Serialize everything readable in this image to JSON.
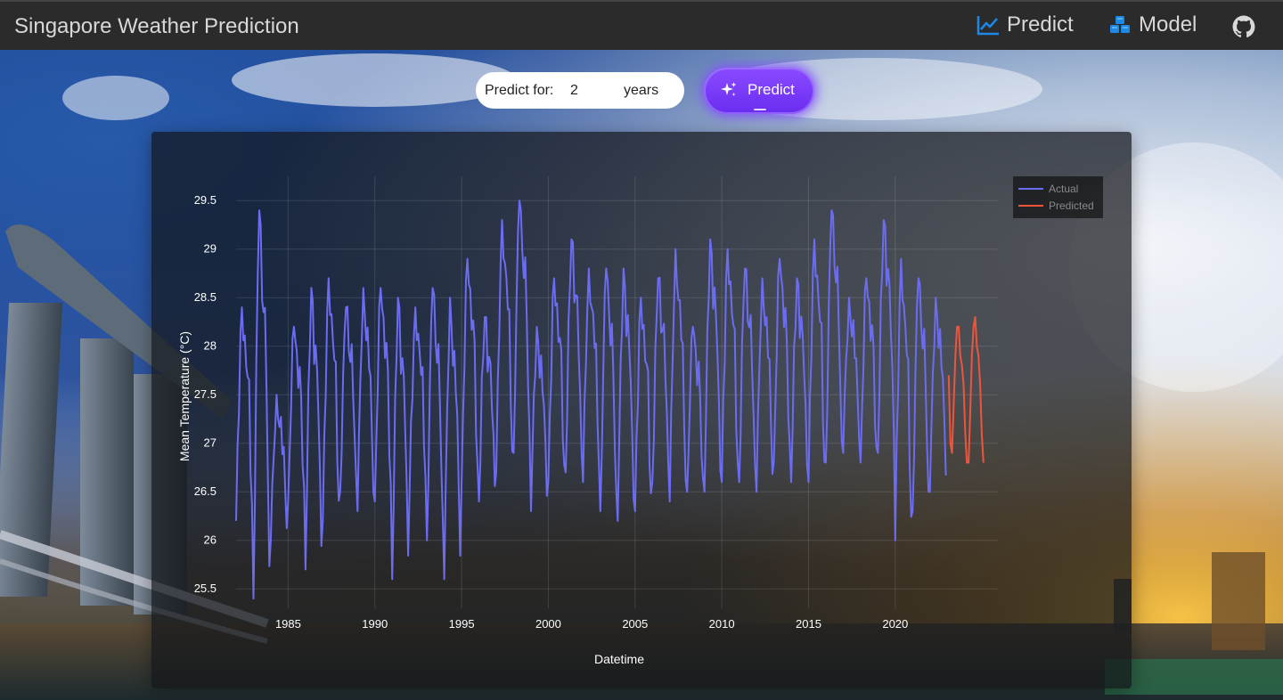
{
  "navbar": {
    "title": "Singapore Weather Prediction",
    "items": [
      {
        "label": "Predict",
        "icon": "line-chart-icon"
      },
      {
        "label": "Model",
        "icon": "cubes-icon"
      },
      {
        "label": "",
        "icon": "github-icon"
      }
    ]
  },
  "controls": {
    "predict_for_label": "Predict for:",
    "years_value": "2",
    "years_unit": "years",
    "predict_button_label": "Predict",
    "predict_button_icon": "sparkles-icon"
  },
  "colors": {
    "actual": "#6b6cf2",
    "predicted": "#ef553b",
    "nav_accent": "#1e88e5",
    "button": "#7a3cff"
  },
  "chart_data": {
    "type": "line",
    "xlabel": "Datetime",
    "ylabel": "Mean Temperature (°C)",
    "x_ticks": [
      1985,
      1990,
      1995,
      2000,
      2005,
      2010,
      2015,
      2020
    ],
    "y_ticks": [
      25.5,
      26,
      26.5,
      27,
      27.5,
      28,
      28.5,
      29,
      29.5
    ],
    "xlim": [
      "1982-01",
      "2025-12"
    ],
    "ylim": [
      25.3,
      29.75
    ],
    "grid": true,
    "legend_position": "top-right",
    "seasonal_pattern": [
      26.2,
      26.9,
      27.6,
      28.2,
      28.6,
      28.4,
      28.1,
      28.0,
      27.9,
      27.6,
      26.9,
      26.4
    ],
    "series": [
      {
        "name": "Actual",
        "start": "1982-01",
        "end": "2023-02",
        "annual_peaks": [
          28.4,
          29.4,
          27.5,
          28.2,
          28.6,
          28.7,
          28.4,
          28.6,
          28.6,
          28.5,
          28.4,
          28.6,
          28.5,
          28.9,
          28.3,
          29.3,
          29.5,
          28.2,
          28.7,
          29.1,
          28.8,
          28.8,
          28.8,
          28.5,
          28.7,
          29.0,
          28.2,
          29.1,
          29.0,
          28.8,
          28.7,
          28.9,
          28.7,
          29.1,
          29.4,
          28.5,
          28.7,
          29.3,
          28.9,
          28.7,
          28.5
        ],
        "annual_lows": [
          26.2,
          25.4,
          26.0,
          26.4,
          25.7,
          26.2,
          26.5,
          26.3,
          26.4,
          25.6,
          26.5,
          26.0,
          25.6,
          26.6,
          26.4,
          26.7,
          26.9,
          26.3,
          26.6,
          26.7,
          26.6,
          26.3,
          26.2,
          26.3,
          26.6,
          26.4,
          26.5,
          26.5,
          26.6,
          26.6,
          26.5,
          26.8,
          26.6,
          26.6,
          26.8,
          26.9,
          26.8,
          26.9,
          26.0,
          26.3,
          26.5
        ]
      },
      {
        "name": "Predicted",
        "start": "2023-02",
        "end": "2025-02",
        "values": [
          27.7,
          27.0,
          26.9,
          27.4,
          27.9,
          28.2,
          28.2,
          27.9,
          27.8,
          27.6,
          27.1,
          26.8,
          26.8,
          27.3,
          27.9,
          28.2,
          28.3,
          28.0,
          27.9,
          27.6,
          27.1,
          26.8
        ]
      }
    ]
  }
}
